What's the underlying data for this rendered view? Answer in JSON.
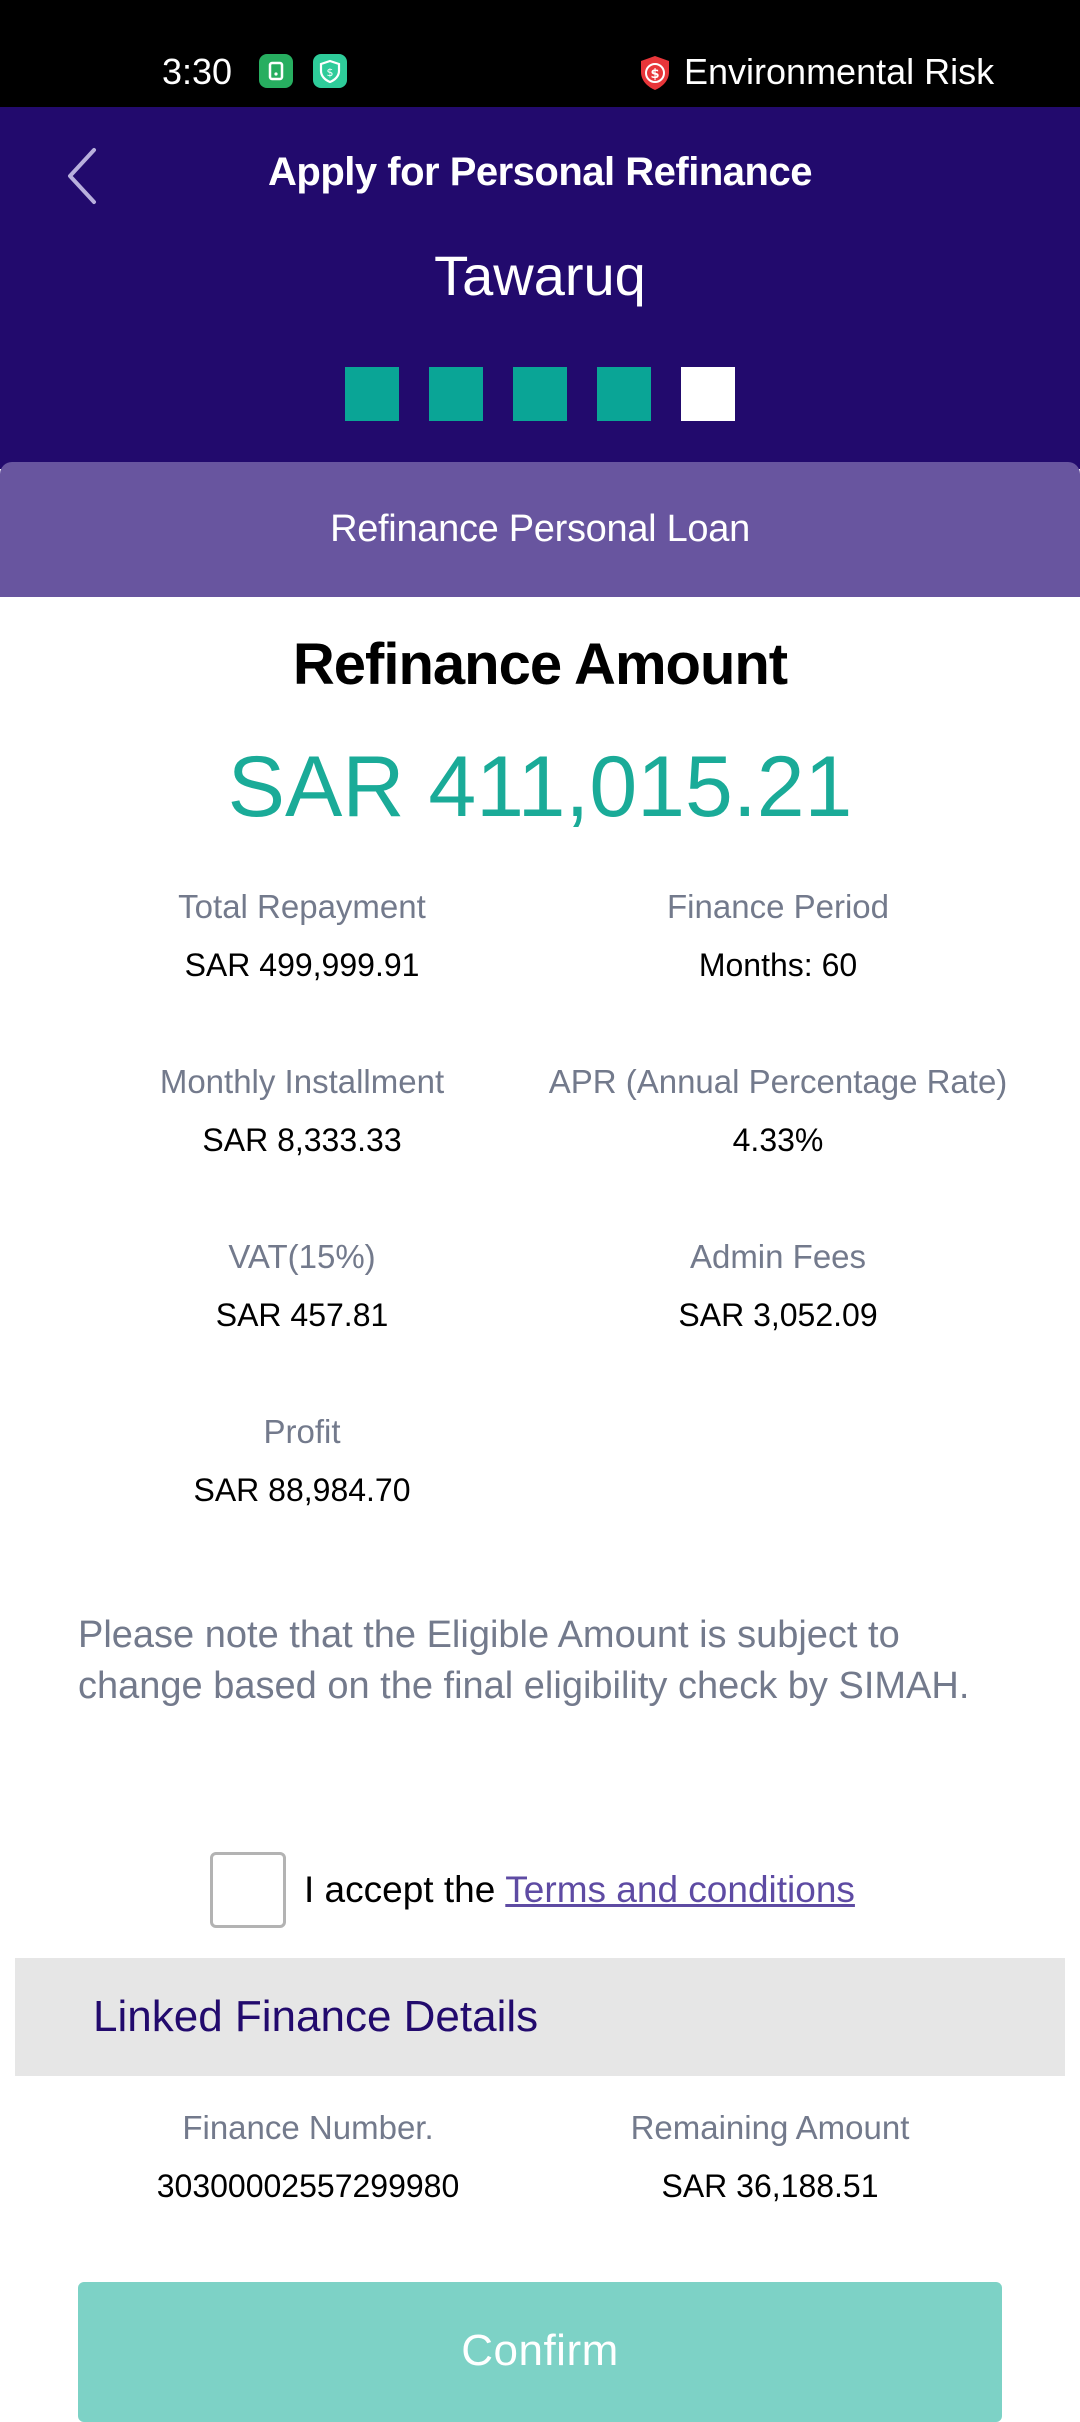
{
  "status_bar": {
    "time": "3:30",
    "risk_label": "Environmental Risk",
    "icons": [
      "app-notification-icon",
      "security-app-icon",
      "risk-shield-icon"
    ]
  },
  "header": {
    "title": "Apply for Personal Refinance",
    "subtitle": "Tawaruq",
    "steps": [
      {
        "state": "done",
        "color": "#0aa596"
      },
      {
        "state": "done",
        "color": "#0aa596"
      },
      {
        "state": "done",
        "color": "#0aa596"
      },
      {
        "state": "done",
        "color": "#0aa596"
      },
      {
        "state": "current",
        "color": "#ffffff"
      }
    ]
  },
  "section": {
    "title": "Refinance Personal Loan"
  },
  "summary": {
    "title": "Refinance Amount",
    "amount": "SAR 411,015.21",
    "details": [
      {
        "label": "Total Repayment",
        "value": "SAR 499,999.91"
      },
      {
        "label": "Finance Period",
        "value": "Months: 60"
      },
      {
        "label": "Monthly Installment",
        "value": "SAR 8,333.33"
      },
      {
        "label": "APR (Annual Percentage Rate)",
        "value": "4.33%"
      },
      {
        "label": "VAT(15%)",
        "value": "SAR 457.81"
      },
      {
        "label": "Admin Fees",
        "value": "SAR 3,052.09"
      },
      {
        "label": "Profit",
        "value": "SAR 88,984.70"
      }
    ]
  },
  "note": "Please note that the Eligible Amount is subject to change based on the final eligibility check by SIMAH.",
  "terms": {
    "prefix": "I accept the",
    "link": "Terms and conditions",
    "checked": false
  },
  "linked": {
    "title": "Linked Finance Details",
    "details": [
      {
        "label": "Finance Number.",
        "value": "30300002557299980"
      },
      {
        "label": "Remaining Amount",
        "value": "SAR 36,188.51"
      }
    ]
  },
  "actions": {
    "confirm_label": "Confirm"
  },
  "colors": {
    "header_bg": "#220a6d",
    "section_band": "#68559f",
    "accent_teal": "#1aab98",
    "confirm_disabled": "#7dd2c6",
    "link": "#5e4ba3"
  }
}
